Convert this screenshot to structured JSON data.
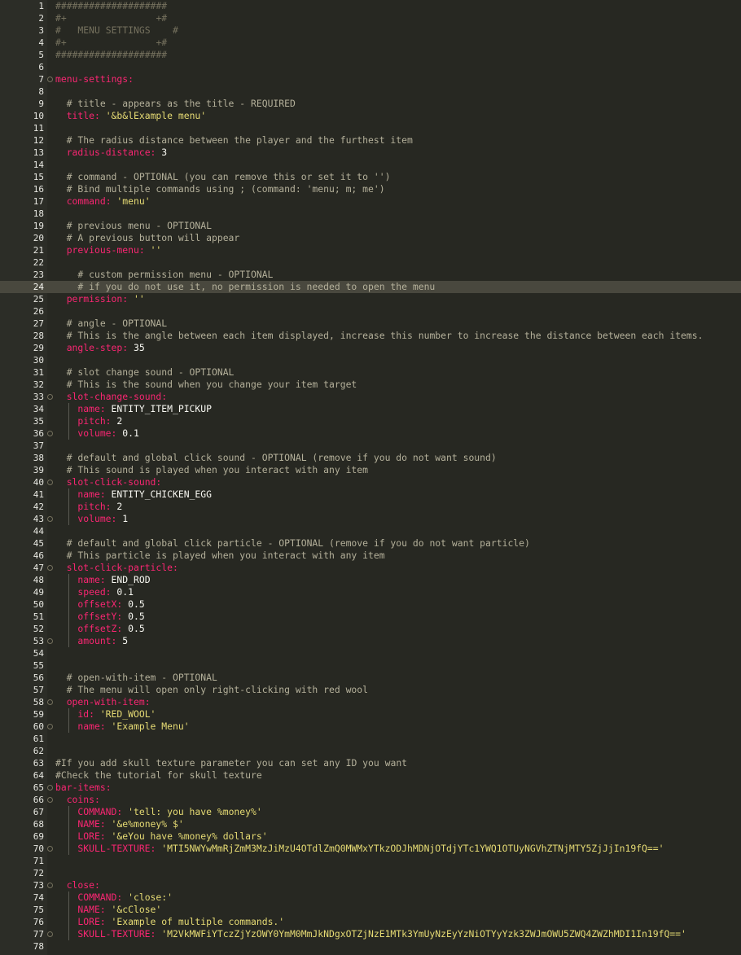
{
  "theme": {
    "background": "#272822",
    "key_color": "#f92672",
    "string_color": "#e6db74",
    "comment_color": "#75715e"
  },
  "lines": [
    {
      "n": "1",
      "indent": 0,
      "parts": [
        {
          "c": "hdr",
          "t": "####################"
        }
      ]
    },
    {
      "n": "2",
      "indent": 0,
      "parts": [
        {
          "c": "hdr",
          "t": "#+                +#"
        }
      ]
    },
    {
      "n": "3",
      "indent": 0,
      "parts": [
        {
          "c": "hdr",
          "t": "#   MENU SETTINGS    #"
        }
      ]
    },
    {
      "n": "4",
      "indent": 0,
      "parts": [
        {
          "c": "hdr",
          "t": "#+                +#"
        }
      ]
    },
    {
      "n": "5",
      "indent": 0,
      "parts": [
        {
          "c": "hdr",
          "t": "####################"
        }
      ]
    },
    {
      "n": "6",
      "indent": 0,
      "parts": []
    },
    {
      "n": "7",
      "indent": 0,
      "fold": true,
      "parts": [
        {
          "c": "key",
          "t": "menu-settings:"
        }
      ]
    },
    {
      "n": "8",
      "indent": 0,
      "parts": []
    },
    {
      "n": "9",
      "indent": 2,
      "parts": [
        {
          "c": "cm",
          "t": "# title - appears as the title - REQUIRED"
        }
      ]
    },
    {
      "n": "10",
      "indent": 2,
      "parts": [
        {
          "c": "key",
          "t": "title: "
        },
        {
          "c": "str",
          "t": "'&b&lExample menu'"
        }
      ]
    },
    {
      "n": "11",
      "indent": 0,
      "parts": []
    },
    {
      "n": "12",
      "indent": 2,
      "parts": [
        {
          "c": "cm",
          "t": "# The radius distance between the player and the furthest item"
        }
      ]
    },
    {
      "n": "13",
      "indent": 2,
      "parts": [
        {
          "c": "key",
          "t": "radius-distance: "
        },
        {
          "c": "num",
          "t": "3"
        }
      ]
    },
    {
      "n": "14",
      "indent": 0,
      "parts": []
    },
    {
      "n": "15",
      "indent": 2,
      "parts": [
        {
          "c": "cm",
          "t": "# command - OPTIONAL (you can remove this or set it to '')"
        }
      ]
    },
    {
      "n": "16",
      "indent": 2,
      "parts": [
        {
          "c": "cm",
          "t": "# Bind multiple commands using ; (command: 'menu; m; me')"
        }
      ]
    },
    {
      "n": "17",
      "indent": 2,
      "parts": [
        {
          "c": "key",
          "t": "command: "
        },
        {
          "c": "str",
          "t": "'menu'"
        }
      ]
    },
    {
      "n": "18",
      "indent": 0,
      "parts": []
    },
    {
      "n": "19",
      "indent": 2,
      "parts": [
        {
          "c": "cm",
          "t": "# previous menu - OPTIONAL"
        }
      ]
    },
    {
      "n": "20",
      "indent": 2,
      "parts": [
        {
          "c": "cm",
          "t": "# A previous button will appear"
        }
      ]
    },
    {
      "n": "21",
      "indent": 2,
      "parts": [
        {
          "c": "key",
          "t": "previous-menu: "
        },
        {
          "c": "str",
          "t": "''"
        }
      ]
    },
    {
      "n": "22",
      "indent": 0,
      "parts": []
    },
    {
      "n": "23",
      "indent": 4,
      "parts": [
        {
          "c": "cm",
          "t": "# custom permission menu - OPTIONAL"
        }
      ]
    },
    {
      "n": "24",
      "indent": 4,
      "hl": true,
      "parts": [
        {
          "c": "cm",
          "t": "# if you do not use it, no permission is needed to open the menu"
        }
      ]
    },
    {
      "n": "25",
      "indent": 2,
      "parts": [
        {
          "c": "key",
          "t": "permission: "
        },
        {
          "c": "str",
          "t": "''"
        }
      ]
    },
    {
      "n": "26",
      "indent": 0,
      "parts": []
    },
    {
      "n": "27",
      "indent": 2,
      "parts": [
        {
          "c": "cm",
          "t": "# angle - OPTIONAL"
        }
      ]
    },
    {
      "n": "28",
      "indent": 2,
      "parts": [
        {
          "c": "cm",
          "t": "# This is the angle between each item displayed, increase this number to increase the distance between each items."
        }
      ]
    },
    {
      "n": "29",
      "indent": 2,
      "parts": [
        {
          "c": "key",
          "t": "angle-step: "
        },
        {
          "c": "num",
          "t": "35"
        }
      ]
    },
    {
      "n": "30",
      "indent": 0,
      "parts": []
    },
    {
      "n": "31",
      "indent": 2,
      "parts": [
        {
          "c": "cm",
          "t": "# slot change sound - OPTIONAL"
        }
      ]
    },
    {
      "n": "32",
      "indent": 2,
      "parts": [
        {
          "c": "cm",
          "t": "# This is the sound when you change your item target"
        }
      ]
    },
    {
      "n": "33",
      "indent": 2,
      "fold": true,
      "parts": [
        {
          "c": "key",
          "t": "slot-change-sound:"
        }
      ]
    },
    {
      "n": "34",
      "indent": 4,
      "guide": true,
      "parts": [
        {
          "c": "key",
          "t": "name: "
        },
        {
          "c": "plain",
          "t": "ENTITY_ITEM_PICKUP"
        }
      ]
    },
    {
      "n": "35",
      "indent": 4,
      "guide": true,
      "parts": [
        {
          "c": "key",
          "t": "pitch: "
        },
        {
          "c": "num",
          "t": "2"
        }
      ]
    },
    {
      "n": "36",
      "indent": 4,
      "guide": true,
      "fold": true,
      "parts": [
        {
          "c": "key",
          "t": "volume: "
        },
        {
          "c": "num",
          "t": "0.1"
        }
      ]
    },
    {
      "n": "37",
      "indent": 0,
      "parts": []
    },
    {
      "n": "38",
      "indent": 2,
      "parts": [
        {
          "c": "cm",
          "t": "# default and global click sound - OPTIONAL (remove if you do not want sound)"
        }
      ]
    },
    {
      "n": "39",
      "indent": 2,
      "parts": [
        {
          "c": "cm",
          "t": "# This sound is played when you interact with any item"
        }
      ]
    },
    {
      "n": "40",
      "indent": 2,
      "fold": true,
      "parts": [
        {
          "c": "key",
          "t": "slot-click-sound:"
        }
      ]
    },
    {
      "n": "41",
      "indent": 4,
      "guide": true,
      "parts": [
        {
          "c": "key",
          "t": "name: "
        },
        {
          "c": "plain",
          "t": "ENTITY_CHICKEN_EGG"
        }
      ]
    },
    {
      "n": "42",
      "indent": 4,
      "guide": true,
      "parts": [
        {
          "c": "key",
          "t": "pitch: "
        },
        {
          "c": "num",
          "t": "2"
        }
      ]
    },
    {
      "n": "43",
      "indent": 4,
      "guide": true,
      "fold": true,
      "parts": [
        {
          "c": "key",
          "t": "volume: "
        },
        {
          "c": "num",
          "t": "1"
        }
      ]
    },
    {
      "n": "44",
      "indent": 0,
      "parts": []
    },
    {
      "n": "45",
      "indent": 2,
      "parts": [
        {
          "c": "cm",
          "t": "# default and global click particle - OPTIONAL (remove if you do not want particle)"
        }
      ]
    },
    {
      "n": "46",
      "indent": 2,
      "parts": [
        {
          "c": "cm",
          "t": "# This particle is played when you interact with any item"
        }
      ]
    },
    {
      "n": "47",
      "indent": 2,
      "fold": true,
      "parts": [
        {
          "c": "key",
          "t": "slot-click-particle:"
        }
      ]
    },
    {
      "n": "48",
      "indent": 4,
      "guide": true,
      "parts": [
        {
          "c": "key",
          "t": "name: "
        },
        {
          "c": "plain",
          "t": "END_ROD"
        }
      ]
    },
    {
      "n": "49",
      "indent": 4,
      "guide": true,
      "parts": [
        {
          "c": "key",
          "t": "speed: "
        },
        {
          "c": "num",
          "t": "0.1"
        }
      ]
    },
    {
      "n": "50",
      "indent": 4,
      "guide": true,
      "parts": [
        {
          "c": "key",
          "t": "offsetX: "
        },
        {
          "c": "num",
          "t": "0.5"
        }
      ]
    },
    {
      "n": "51",
      "indent": 4,
      "guide": true,
      "parts": [
        {
          "c": "key",
          "t": "offsetY: "
        },
        {
          "c": "num",
          "t": "0.5"
        }
      ]
    },
    {
      "n": "52",
      "indent": 4,
      "guide": true,
      "parts": [
        {
          "c": "key",
          "t": "offsetZ: "
        },
        {
          "c": "num",
          "t": "0.5"
        }
      ]
    },
    {
      "n": "53",
      "indent": 4,
      "guide": true,
      "fold": true,
      "parts": [
        {
          "c": "key",
          "t": "amount: "
        },
        {
          "c": "num",
          "t": "5"
        }
      ]
    },
    {
      "n": "54",
      "indent": 0,
      "parts": []
    },
    {
      "n": "55",
      "indent": 0,
      "parts": []
    },
    {
      "n": "56",
      "indent": 2,
      "parts": [
        {
          "c": "cm",
          "t": "# open-with-item - OPTIONAL"
        }
      ]
    },
    {
      "n": "57",
      "indent": 2,
      "parts": [
        {
          "c": "cm",
          "t": "# The menu will open only right-clicking with red wool"
        }
      ]
    },
    {
      "n": "58",
      "indent": 2,
      "fold": true,
      "parts": [
        {
          "c": "key",
          "t": "open-with-item:"
        }
      ]
    },
    {
      "n": "59",
      "indent": 4,
      "guide": true,
      "parts": [
        {
          "c": "key",
          "t": "id: "
        },
        {
          "c": "str",
          "t": "'RED_WOOL'"
        }
      ]
    },
    {
      "n": "60",
      "indent": 4,
      "guide": true,
      "fold": true,
      "parts": [
        {
          "c": "key",
          "t": "name: "
        },
        {
          "c": "str",
          "t": "'Example Menu'"
        }
      ]
    },
    {
      "n": "61",
      "indent": 0,
      "parts": []
    },
    {
      "n": "62",
      "indent": 0,
      "parts": []
    },
    {
      "n": "63",
      "indent": 0,
      "parts": [
        {
          "c": "cm",
          "t": "#If you add skull texture parameter you can set any ID you want"
        }
      ]
    },
    {
      "n": "64",
      "indent": 0,
      "parts": [
        {
          "c": "cm",
          "t": "#Check the tutorial for skull texture"
        }
      ]
    },
    {
      "n": "65",
      "indent": 0,
      "fold": true,
      "parts": [
        {
          "c": "key",
          "t": "bar-items:"
        }
      ]
    },
    {
      "n": "66",
      "indent": 2,
      "fold": true,
      "parts": [
        {
          "c": "key",
          "t": "coins:"
        }
      ]
    },
    {
      "n": "67",
      "indent": 4,
      "guide": true,
      "parts": [
        {
          "c": "key",
          "t": "COMMAND: "
        },
        {
          "c": "str",
          "t": "'tell: you have %money%'"
        }
      ]
    },
    {
      "n": "68",
      "indent": 4,
      "guide": true,
      "parts": [
        {
          "c": "key",
          "t": "NAME: "
        },
        {
          "c": "str",
          "t": "'&e%money% $'"
        }
      ]
    },
    {
      "n": "69",
      "indent": 4,
      "guide": true,
      "parts": [
        {
          "c": "key",
          "t": "LORE: "
        },
        {
          "c": "str",
          "t": "'&eYou have %money% dollars'"
        }
      ]
    },
    {
      "n": "70",
      "indent": 4,
      "guide": true,
      "fold": true,
      "parts": [
        {
          "c": "key",
          "t": "SKULL-TEXTURE: "
        },
        {
          "c": "str",
          "t": "'MTI5NWYwMmRjZmM3MzJiMzU4OTdlZmQ0MWMxYTkzODJhMDNjOTdjYTc1YWQ1OTUyNGVhZTNjMTY5ZjJjIn19fQ=='"
        }
      ]
    },
    {
      "n": "71",
      "indent": 0,
      "parts": []
    },
    {
      "n": "72",
      "indent": 0,
      "parts": []
    },
    {
      "n": "73",
      "indent": 2,
      "fold": true,
      "parts": [
        {
          "c": "key",
          "t": "close:"
        }
      ]
    },
    {
      "n": "74",
      "indent": 4,
      "guide": true,
      "parts": [
        {
          "c": "key",
          "t": "COMMAND: "
        },
        {
          "c": "str",
          "t": "'close:'"
        }
      ]
    },
    {
      "n": "75",
      "indent": 4,
      "guide": true,
      "parts": [
        {
          "c": "key",
          "t": "NAME: "
        },
        {
          "c": "str",
          "t": "'&cClose'"
        }
      ]
    },
    {
      "n": "76",
      "indent": 4,
      "guide": true,
      "parts": [
        {
          "c": "key",
          "t": "LORE: "
        },
        {
          "c": "str",
          "t": "'Example of multiple commands.'"
        }
      ]
    },
    {
      "n": "77",
      "indent": 4,
      "guide": true,
      "fold": true,
      "parts": [
        {
          "c": "key",
          "t": "SKULL-TEXTURE: "
        },
        {
          "c": "str",
          "t": "'M2VkMWFiYTczZjYzOWY0YmM0MmJkNDgxOTZjNzE1MTk3YmUyNzEyYzNiOTYyYzk3ZWJmOWU5ZWQ4ZWZhMDI1In19fQ=='"
        }
      ]
    },
    {
      "n": "78",
      "indent": 0,
      "parts": []
    }
  ]
}
